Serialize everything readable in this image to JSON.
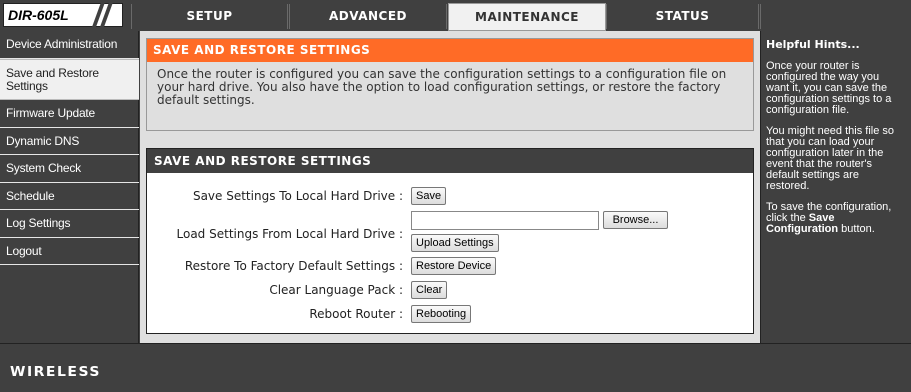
{
  "header": {
    "model": "DIR-605L",
    "nav": [
      {
        "label": "SETUP",
        "active": false
      },
      {
        "label": "ADVANCED",
        "active": false
      },
      {
        "label": "MAINTENANCE",
        "active": true
      },
      {
        "label": "STATUS",
        "active": false
      }
    ]
  },
  "sidebar": {
    "items": [
      {
        "label": "Device Administration"
      },
      {
        "label": "Save and Restore Settings"
      },
      {
        "label": "Firmware Update"
      },
      {
        "label": "Dynamic DNS"
      },
      {
        "label": "System Check"
      },
      {
        "label": "Schedule"
      },
      {
        "label": "Log Settings"
      },
      {
        "label": "Logout"
      }
    ]
  },
  "intro": {
    "title": "SAVE AND RESTORE SETTINGS",
    "text": "Once the router is configured you can save the configuration settings to a configuration file on your hard drive. You also have the option to load configuration settings, or restore the factory default settings."
  },
  "panel": {
    "title": "SAVE AND RESTORE SETTINGS",
    "save_label": "Save Settings To Local Hard Drive :",
    "save_button": "Save",
    "load_label": "Load Settings From Local Hard Drive :",
    "browse_button": "Browse...",
    "upload_button": "Upload Settings",
    "restore_label": "Restore To Factory Default Settings :",
    "restore_button": "Restore Device",
    "clear_label": "Clear Language Pack :",
    "clear_button": "Clear",
    "reboot_label": "Reboot Router :",
    "reboot_button": "Rebooting",
    "file_value": ""
  },
  "hints": {
    "title": "Helpful Hints...",
    "p1": "Once your router is configured the way you want it, you can save the configuration settings to a configuration file.",
    "p2": "You might need this file so that you can load your configuration later in the event that the router's default settings are restored.",
    "p3_prefix": "To save the configuration, click the ",
    "p3_bold": "Save Configuration",
    "p3_suffix": " button."
  },
  "footer": {
    "brand": "WIRELESS"
  },
  "colors": {
    "accent": "#ff6b26",
    "chrome": "#404040",
    "content_bg": "#dfdfdf"
  }
}
